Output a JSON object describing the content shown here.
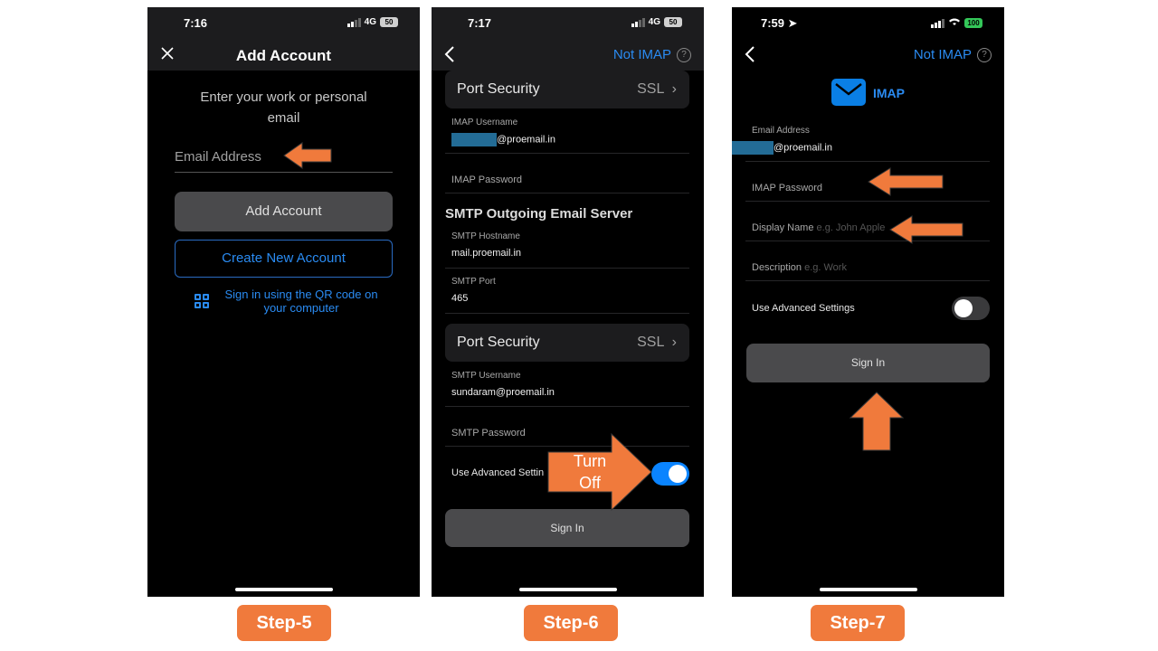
{
  "colors": {
    "accent": "#2a8bf2",
    "arrow": "#f07a3c",
    "step_badge": "#f07a3c"
  },
  "phone1": {
    "time": "7:16",
    "network": "4G",
    "battery": "50",
    "nav": {
      "close_icon": "close-icon",
      "title": "Add Account"
    },
    "prompt": "Enter your work or personal email",
    "email_placeholder": "Email Address",
    "add_account": "Add Account",
    "create_new": "Create New Account",
    "qr_text": "Sign in using the QR code on your computer"
  },
  "phone2": {
    "time": "7:17",
    "network": "4G",
    "battery": "50",
    "nav": {
      "back_icon": "chevron-left-icon",
      "right_link": "Not IMAP",
      "help": "?"
    },
    "port_security_1": {
      "label": "Port Security",
      "value": "SSL"
    },
    "imap_username": {
      "label": "IMAP Username",
      "value_suffix": "@proemail.in"
    },
    "imap_password": {
      "label": "IMAP Password"
    },
    "smtp_section": "SMTP Outgoing Email Server",
    "smtp_hostname": {
      "label": "SMTP Hostname",
      "value": "mail.proemail.in"
    },
    "smtp_port": {
      "label": "SMTP Port",
      "value": "465"
    },
    "port_security_2": {
      "label": "Port Security",
      "value": "SSL"
    },
    "smtp_username": {
      "label": "SMTP Username",
      "value": "sundaram@proemail.in"
    },
    "smtp_password": {
      "label": "SMTP Password"
    },
    "advanced": {
      "label": "Use Advanced Settin",
      "enabled": true
    },
    "sign_in": "Sign In",
    "annotation_line1": "Turn",
    "annotation_line2": "Off"
  },
  "phone3": {
    "time": "7:59",
    "battery": "100",
    "nav": {
      "back_icon": "chevron-left-icon",
      "right_link": "Not IMAP",
      "help": "?"
    },
    "logo_label": "IMAP",
    "email": {
      "label": "Email Address",
      "value_suffix": "@proemail.in"
    },
    "imap_password": {
      "label": "IMAP Password"
    },
    "display_name": {
      "label": "Display Name",
      "placeholder": "e.g. John Apple"
    },
    "description": {
      "label": "Description",
      "placeholder": "e.g. Work"
    },
    "advanced": {
      "label": "Use Advanced Settings",
      "enabled": false
    },
    "sign_in": "Sign In"
  },
  "steps": [
    "Step-5",
    "Step-6",
    "Step-7"
  ]
}
